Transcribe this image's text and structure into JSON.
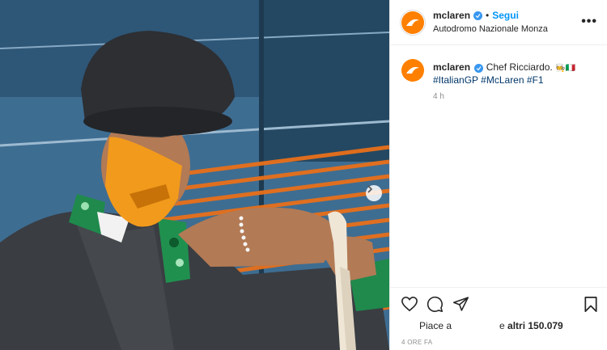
{
  "post": {
    "username": "mclaren",
    "dot": "•",
    "follow_label": "Segui",
    "location": "Autodromo Nazionale Monza",
    "more_label": "•••",
    "caption_user": "mclaren",
    "caption_text": "Chef Ricciardo.",
    "caption_flag": "🧑‍🍳🇮🇹",
    "hashtags": [
      "#ItalianGP",
      "#McLaren",
      "#F1"
    ],
    "comment_time": "4 h",
    "likes_prefix": "Piace a",
    "likes_suffix_prefix": "e ",
    "likes_count": "altri 150.079",
    "date": "4 ORE FA"
  },
  "colors": {
    "brand": "#ff8000",
    "link": "#0095f6",
    "hashtag": "#00376b",
    "muted": "#8e8e8e"
  },
  "icons": [
    "verified-icon",
    "heart-icon",
    "comment-icon",
    "share-icon",
    "bookmark-icon",
    "next-arrow-icon",
    "more-icon"
  ]
}
